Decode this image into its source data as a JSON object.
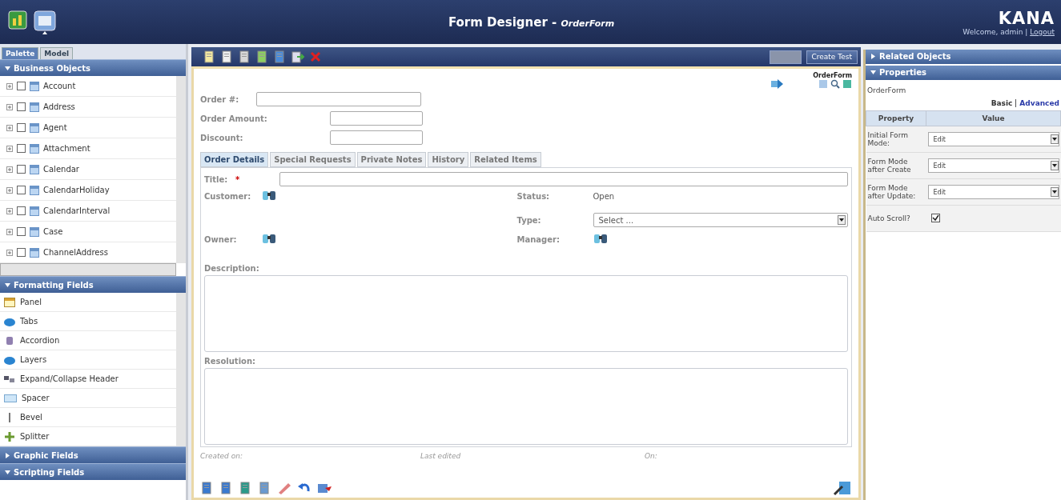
{
  "header": {
    "title": "Form Designer -",
    "form_name": "OrderForm",
    "brand": "KANA",
    "welcome": "Welcome, admin |",
    "logout": "Logout"
  },
  "palette": {
    "tabs": [
      {
        "label": "Palette",
        "selected": true
      },
      {
        "label": "Model",
        "selected": false
      }
    ],
    "sections": [
      {
        "title": "Business Objects",
        "expanded": true,
        "kind": "objects",
        "items": [
          {
            "label": "Account",
            "checked": false
          },
          {
            "label": "Address",
            "checked": false
          },
          {
            "label": "Agent",
            "checked": false
          },
          {
            "label": "Attachment",
            "checked": false
          },
          {
            "label": "Calendar",
            "checked": false
          },
          {
            "label": "CalendarHoliday",
            "checked": false
          },
          {
            "label": "CalendarInterval",
            "checked": false
          },
          {
            "label": "Case",
            "checked": false
          },
          {
            "label": "ChannelAddress",
            "checked": false
          }
        ]
      },
      {
        "title": "Formatting Fields",
        "expanded": true,
        "kind": "fields",
        "items": [
          {
            "label": "Panel"
          },
          {
            "label": "Tabs"
          },
          {
            "label": "Accordion"
          },
          {
            "label": "Layers"
          },
          {
            "label": "Expand/Collapse Header"
          },
          {
            "label": "Spacer"
          },
          {
            "label": "Bevel"
          },
          {
            "label": "Splitter"
          }
        ]
      },
      {
        "title": "Graphic Fields",
        "expanded": false
      },
      {
        "title": "Scripting Fields",
        "expanded": true
      }
    ]
  },
  "designer": {
    "toolbar_buttons": [
      {
        "disabled": true
      },
      {
        "label": "Create Test",
        "disabled": false
      }
    ],
    "form_label": "OrderForm",
    "top_fields": [
      {
        "label": "Order #:"
      },
      {
        "label": "Order Amount:"
      },
      {
        "label": "Discount:"
      }
    ],
    "tabs": [
      {
        "label": "Order Details",
        "selected": true
      },
      {
        "label": "Special Requests",
        "selected": false
      },
      {
        "label": "Private Notes",
        "selected": false
      },
      {
        "label": "History",
        "selected": false
      },
      {
        "label": "Related Items",
        "selected": false
      }
    ],
    "title_field": {
      "label": "Title:",
      "required_mark": "*"
    },
    "customer": {
      "label": "Customer:"
    },
    "status": {
      "label": "Status:",
      "value": "Open"
    },
    "type": {
      "label": "Type:",
      "value": "Select ..."
    },
    "owner": {
      "label": "Owner:"
    },
    "manager": {
      "label": "Manager:"
    },
    "description": {
      "label": "Description:"
    },
    "resolution": {
      "label": "Resolution:"
    },
    "footer": [
      "Created on:",
      "Last edited",
      "On:"
    ]
  },
  "properties": {
    "related": {
      "title": "Related Objects",
      "expanded": false
    },
    "panel": {
      "title": "Properties",
      "expanded": true
    },
    "object_name": "OrderForm",
    "views": [
      {
        "label": "Basic",
        "selected": true
      },
      {
        "label": "Advanced",
        "selected": false
      }
    ],
    "columns": [
      "Property",
      "Value"
    ],
    "rows": [
      {
        "kind": "select",
        "name": "Initial Form Mode:",
        "value": "Edit"
      },
      {
        "kind": "select",
        "name": "Form Mode after Create",
        "value": "Edit"
      },
      {
        "kind": "select",
        "name": "Form Mode after Update:",
        "value": "Edit"
      },
      {
        "kind": "checkbox",
        "name": "Auto Scroll?",
        "checked": true
      }
    ]
  }
}
